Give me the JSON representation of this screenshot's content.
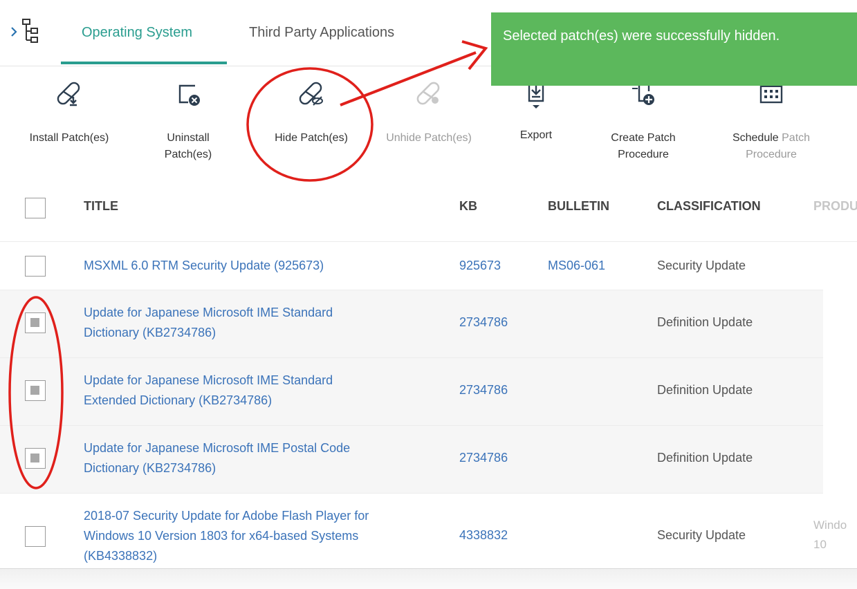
{
  "tabs": {
    "items": [
      {
        "label": "Operating System",
        "active": true
      },
      {
        "label": "Third Party Applications",
        "active": false
      }
    ]
  },
  "toolbar": {
    "install": "Install Patch(es)",
    "uninstall_1": "Uninstall",
    "uninstall_2": "Patch(es)",
    "hide": "Hide Patch(es)",
    "unhide": "Unhide Patch(es)",
    "export": "Export",
    "create_1": "Create Patch",
    "create_2": "Procedure",
    "schedule_1a": "Schedule",
    "schedule_1b": " Patch",
    "schedule_2": "Procedure",
    "icons": [
      "install-patch-icon",
      "uninstall-patch-icon",
      "hide-patch-icon",
      "unhide-patch-icon",
      "export-icon",
      "create-procedure-icon",
      "schedule-procedure-icon"
    ]
  },
  "toast": {
    "message": "Selected patch(es) were successfully hidden.",
    "color": "#5cb85c"
  },
  "table": {
    "columns": {
      "title": "TITLE",
      "kb": "KB",
      "bulletin": "BULLETIN",
      "classification": "CLASSIFICATION",
      "product": "PRODU"
    },
    "rows": [
      {
        "checked": false,
        "title_1": "MSXML 6.0 RTM Security Update (925673)",
        "title_2": "",
        "title_3": "",
        "kb": "925673",
        "bulletin": "MS06-061",
        "classification": "Security Update",
        "product_1": "",
        "product_2": ""
      },
      {
        "checked": true,
        "title_1": "Update for Japanese Microsoft IME Standard",
        "title_2": "Dictionary (KB2734786)",
        "title_3": "",
        "kb": "2734786",
        "bulletin": "",
        "classification": "Definition Update",
        "product_1": "",
        "product_2": ""
      },
      {
        "checked": true,
        "title_1": "Update for Japanese Microsoft IME Standard",
        "title_2": "Extended Dictionary (KB2734786)",
        "title_3": "",
        "kb": "2734786",
        "bulletin": "",
        "classification": "Definition Update",
        "product_1": "",
        "product_2": ""
      },
      {
        "checked": true,
        "title_1": "Update for Japanese Microsoft IME Postal Code",
        "title_2": "Dictionary (KB2734786)",
        "title_3": "",
        "kb": "2734786",
        "bulletin": "",
        "classification": "Definition Update",
        "product_1": "",
        "product_2": ""
      },
      {
        "checked": false,
        "title_1": "2018-07 Security Update for Adobe Flash Player for",
        "title_2": "Windows 10 Version 1803 for x64-based Systems",
        "title_3": "(KB4338832)",
        "kb": "4338832",
        "bulletin": "",
        "classification": "Security Update",
        "product_1": "Windo",
        "product_2": "10"
      }
    ]
  },
  "colors": {
    "accent": "#2a9d8f",
    "link": "#3b73b9",
    "annotation": "#e0201b"
  }
}
